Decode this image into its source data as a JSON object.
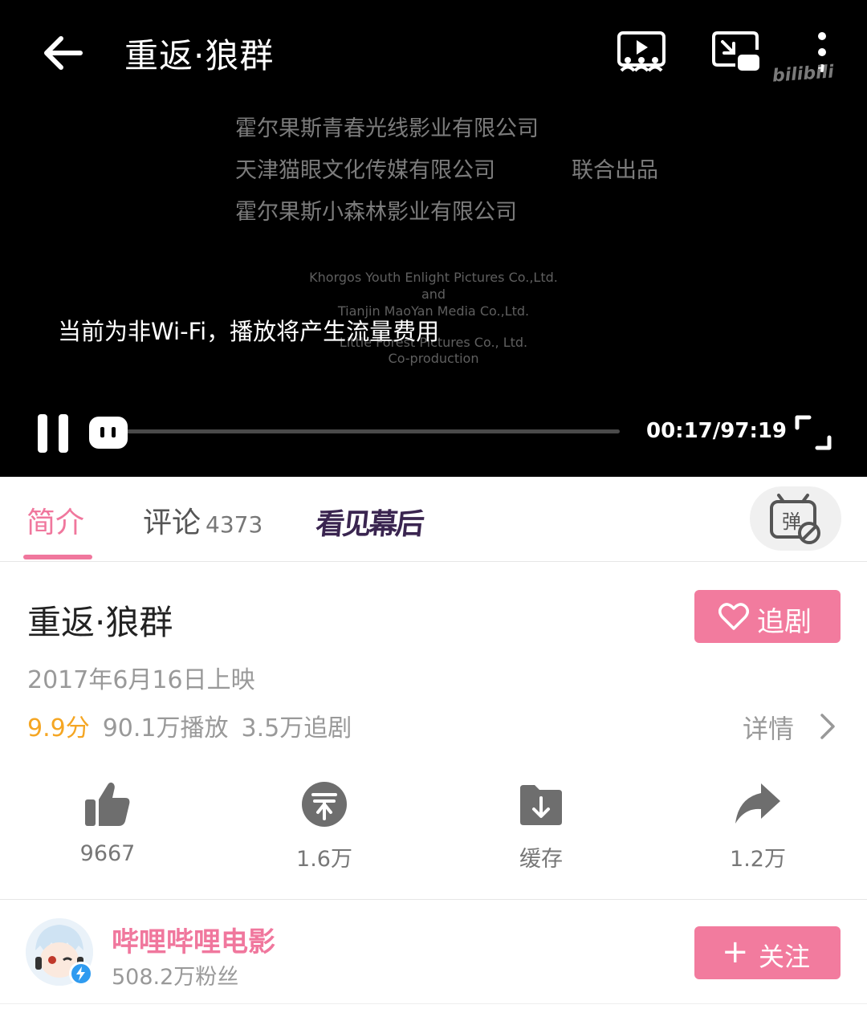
{
  "player": {
    "title": "重返·狼群",
    "watermark": "bilibili",
    "credits_cn": [
      "霍尔果斯青春光线影业有限公司",
      "天津猫眼文化传媒有限公司",
      "霍尔果斯小森林影业有限公司"
    ],
    "credits_cn_suffix": "联合出品",
    "credits_en": [
      "Khorgos Youth Enlight Pictures Co.,Ltd.",
      "and",
      "Tianjin MaoYan Media Co.,Ltd.",
      "Little Forest Pictures Co., Ltd.",
      "Co-production"
    ],
    "traffic_notice": "当前为非Wi-Fi，播放将产生流量费用",
    "time": "00:17/97:19",
    "progress": 0.003
  },
  "tabs": {
    "intro": "简介",
    "comments": "评论",
    "comments_count": "4373",
    "brand": "看见幕后"
  },
  "video": {
    "title": "重返·狼群",
    "follow_series_label": "追剧",
    "release_date": "2017年6月16日上映",
    "score": "9.9分",
    "plays": "90.1万播放",
    "series_follows": "3.5万追剧",
    "detail_label": "详情"
  },
  "actions": {
    "like": "9667",
    "coin": "1.6万",
    "cache": "缓存",
    "share": "1.2万"
  },
  "channel": {
    "name": "哔哩哔哩电影",
    "fans": "508.2万粉丝",
    "follow_label": "关注"
  },
  "colors": {
    "accent": "#f0779d",
    "score": "#f5a623"
  }
}
